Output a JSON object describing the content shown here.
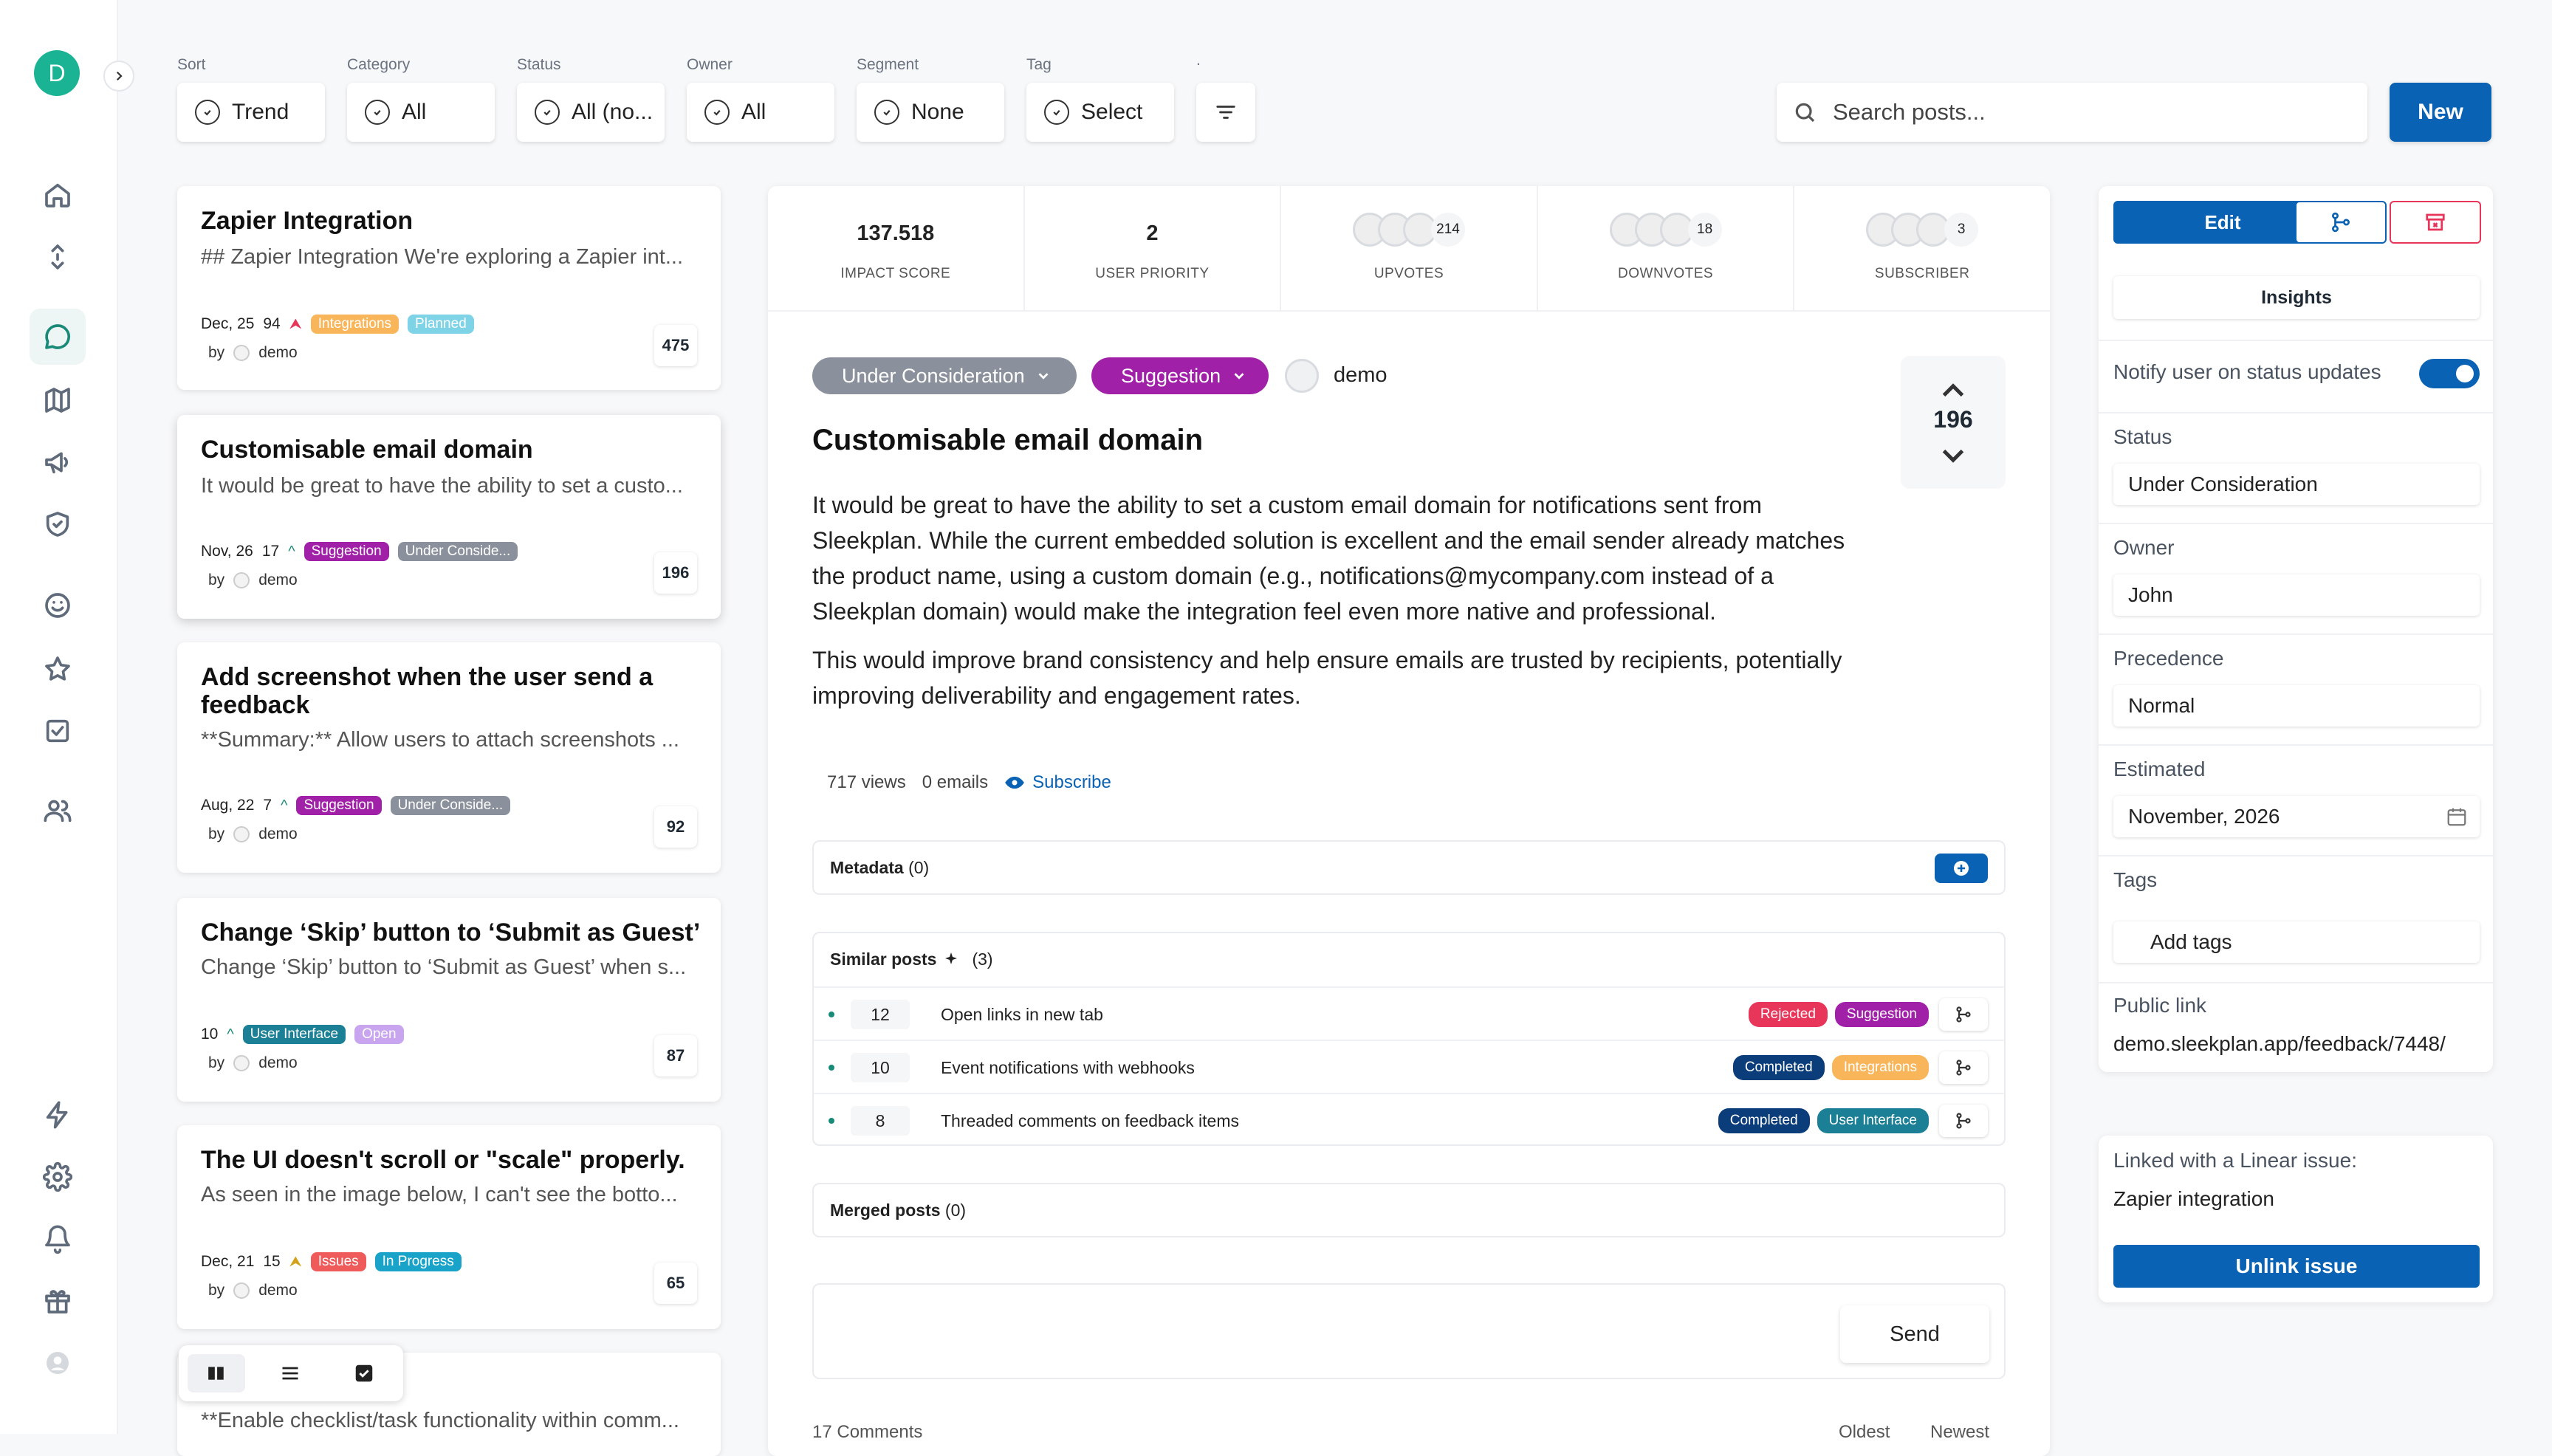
{
  "sidebar": {
    "avatar_initial": "D"
  },
  "filters": [
    {
      "label": "Sort",
      "value": "Trend"
    },
    {
      "label": "Category",
      "value": "All"
    },
    {
      "label": "Status",
      "value": "All (no..."
    },
    {
      "label": "Owner",
      "value": "All"
    },
    {
      "label": "Segment",
      "value": "None"
    },
    {
      "label": "Tag",
      "value": "Select"
    }
  ],
  "filter_extra_label": ".",
  "search": {
    "placeholder": "Search posts..."
  },
  "new_button": "New",
  "posts": [
    {
      "title": "Zapier Integration",
      "desc": "## Zapier Integration We're exploring a Zapier int...",
      "date": "Dec, 25",
      "votes": "94",
      "badges": [
        {
          "text": "Integrations",
          "color": "#f9b55a"
        },
        {
          "text": "Planned",
          "color": "#7fd3e6"
        }
      ],
      "by": "by",
      "author": "demo",
      "count": "475"
    },
    {
      "title": "Customisable email domain",
      "desc": "It would be great to have the ability to set a custo...",
      "date": "Nov, 26",
      "votes": "17",
      "badges": [
        {
          "text": "Suggestion",
          "color": "#a020a8"
        },
        {
          "text": "Under Conside...",
          "color": "#8b919c"
        }
      ],
      "by": "by",
      "author": "demo",
      "count": "196"
    },
    {
      "title": "Add screenshot when the user send a feedback",
      "desc": "**Summary:** Allow users to attach screenshots ...",
      "date": "Aug, 22",
      "votes": "7",
      "badges": [
        {
          "text": "Suggestion",
          "color": "#a020a8"
        },
        {
          "text": "Under Conside...",
          "color": "#8b919c"
        }
      ],
      "by": "by",
      "author": "demo",
      "count": "92"
    },
    {
      "title": "Change ‘Skip’ button to ‘Submit as Guest’",
      "desc": "Change ‘Skip’ button to ‘Submit as Guest’ when s...",
      "date": "",
      "votes": "10",
      "badges": [
        {
          "text": "User Interface",
          "color": "#1b7f95"
        },
        {
          "text": "Open",
          "color": "#c9a5f0"
        }
      ],
      "by": "by",
      "author": "demo",
      "count": "87"
    },
    {
      "title": "The UI doesn't scroll or \"scale\" properly.",
      "desc": "As seen in the image below, I can't see the botto...",
      "date": "Dec, 21",
      "votes": "15",
      "badges": [
        {
          "text": "Issues",
          "color": "#ef5a5a"
        },
        {
          "text": "In Progress",
          "color": "#1aa3c8"
        }
      ],
      "by": "by",
      "author": "demo",
      "count": "65"
    },
    {
      "title": "...s in ...ments",
      "desc": "**Enable checklist/task functionality within comm..."
    }
  ],
  "stats": [
    {
      "value": "137.518",
      "label": "IMPACT SCORE"
    },
    {
      "value": "2",
      "label": "USER PRIORITY"
    },
    {
      "value": "214",
      "label": "UPVOTES"
    },
    {
      "value": "18",
      "label": "DOWNVOTES"
    },
    {
      "value": "3",
      "label": "SUBSCRIBER"
    }
  ],
  "post": {
    "status": "Under Consideration",
    "category": "Suggestion",
    "author": "demo",
    "title": "Customisable email domain",
    "body_1": "It would be great to have the ability to set a custom email domain for notifications sent from Sleekplan. While the current embedded solution is excellent and the email sender already matches the product name, using a custom domain (e.g., notifications@mycompany.com instead of a Sleekplan domain) would make the integration feel even more native and professional.",
    "body_2": "This would improve brand consistency and help ensure emails are trusted by recipients, potentially improving deliverability and engagement rates.",
    "votes": "196",
    "views": "717 views",
    "emails": "0 emails",
    "subscribe": "Subscribe"
  },
  "metadata": {
    "title": "Metadata",
    "count": "(0)"
  },
  "similar": {
    "title": "Similar posts",
    "count": "(3)",
    "rows": [
      {
        "count": "12",
        "title": "Open links in new tab",
        "badges": [
          {
            "text": "Rejected",
            "color": "#e8355a"
          },
          {
            "text": "Suggestion",
            "color": "#a020a8"
          }
        ]
      },
      {
        "count": "10",
        "title": "Event notifications with webhooks",
        "badges": [
          {
            "text": "Completed",
            "color": "#0b3d7a"
          },
          {
            "text": "Integrations",
            "color": "#f9b55a"
          }
        ]
      },
      {
        "count": "8",
        "title": "Threaded comments on feedback items",
        "badges": [
          {
            "text": "Completed",
            "color": "#0b3d7a"
          },
          {
            "text": "User Interface",
            "color": "#1b7f95"
          }
        ]
      }
    ]
  },
  "merged": {
    "title": "Merged posts",
    "count": "(0)"
  },
  "comment": {
    "send": "Send",
    "comments_count": "17 Comments",
    "sort_oldest": "Oldest",
    "sort_newest": "Newest"
  },
  "right": {
    "edit": "Edit",
    "insights": "Insights",
    "notify": "Notify user on status updates",
    "status_label": "Status",
    "status_value": "Under Consideration",
    "owner_label": "Owner",
    "owner_value": "John",
    "precedence_label": "Precedence",
    "precedence_value": "Normal",
    "estimated_label": "Estimated",
    "estimated_value": "November, 2026",
    "tags_label": "Tags",
    "tags_value": "Add tags",
    "public_link_label": "Public link",
    "public_link_value": "demo.sleekplan.app/feedback/7448/",
    "linear_label": "Linked with a Linear issue:",
    "linear_value": "Zapier integration",
    "unlink": "Unlink issue"
  },
  "colors": {
    "primary": "#0a62b4",
    "accent": "#1ab394",
    "status_gray": "#8b919c",
    "suggestion": "#a020a8"
  }
}
